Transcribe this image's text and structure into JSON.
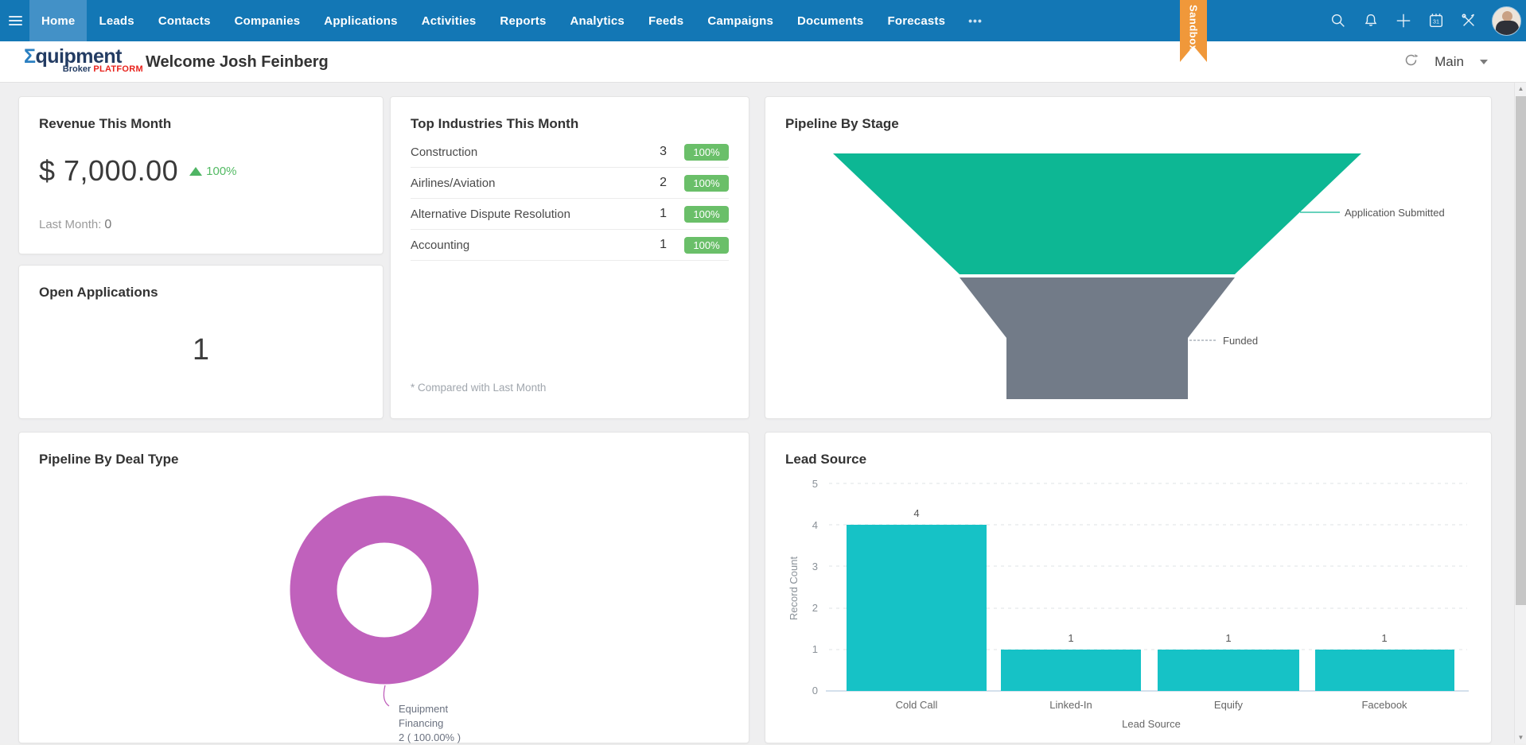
{
  "nav": {
    "items": [
      {
        "label": "Home",
        "active": true
      },
      {
        "label": "Leads"
      },
      {
        "label": "Contacts"
      },
      {
        "label": "Companies"
      },
      {
        "label": "Applications"
      },
      {
        "label": "Activities"
      },
      {
        "label": "Reports"
      },
      {
        "label": "Analytics"
      },
      {
        "label": "Feeds"
      },
      {
        "label": "Campaigns"
      },
      {
        "label": "Documents"
      },
      {
        "label": "Forecasts"
      }
    ],
    "more": "•••",
    "calendar_day": "31",
    "sandbox_label": "Sandbox"
  },
  "header": {
    "logo": {
      "sigma": "Σ",
      "name_rest": "quipment",
      "sub_left": "Broker",
      "sub_right": "PLATFORM"
    },
    "welcome": "Welcome Josh Feinberg",
    "view_selector": "Main"
  },
  "revenue_card": {
    "title": "Revenue This Month",
    "value": "$ 7,000.00",
    "change": "100%",
    "last_month_label": "Last Month:",
    "last_month_value": "0"
  },
  "industries_card": {
    "title": "Top Industries This Month",
    "rows": [
      {
        "name": "Construction",
        "count": "3",
        "change": "100%"
      },
      {
        "name": "Airlines/Aviation",
        "count": "2",
        "change": "100%"
      },
      {
        "name": "Alternative Dispute Resolution",
        "count": "1",
        "change": "100%"
      },
      {
        "name": "Accounting",
        "count": "1",
        "change": "100%"
      }
    ],
    "footnote": "* Compared with Last Month"
  },
  "open_apps_card": {
    "title": "Open Applications",
    "value": "1"
  },
  "funnel_card": {
    "title": "Pipeline By Stage",
    "stage1_label": "Application Submitted",
    "stage2_label": "Funded"
  },
  "dealtype_card": {
    "title": "Pipeline By Deal Type",
    "label_line1": "Equipment",
    "label_line2": "Financing",
    "label_line3": "2 ( 100.00% )"
  },
  "leadsource_card": {
    "title": "Lead Source",
    "xlabel": "Lead Source",
    "ylabel": "Record Count",
    "yticks": {
      "t5": "5",
      "t4": "4",
      "t3": "3",
      "t2": "2",
      "t1": "1",
      "t0": "0"
    },
    "bars": [
      {
        "label": "Cold Call",
        "value": "4"
      },
      {
        "label": "Linked-In",
        "value": "1"
      },
      {
        "label": "Equify",
        "value": "1"
      },
      {
        "label": "Facebook",
        "value": "1"
      }
    ]
  },
  "colors": {
    "nav_blue": "#1377b5",
    "nav_active_blue": "#4391c7",
    "sandbox_orange": "#f0983a",
    "badge_green": "#6abf69",
    "change_green": "#53ba63",
    "funnel_green": "#0db794",
    "funnel_gray": "#727b88",
    "donut_magenta": "#c061bc",
    "bar_cyan": "#16c2c6"
  },
  "chart_data": [
    {
      "type": "funnel",
      "title": "Pipeline By Stage",
      "stages": [
        {
          "label": "Application Submitted",
          "color": "#0db794"
        },
        {
          "label": "Funded",
          "color": "#727b88"
        }
      ]
    },
    {
      "type": "pie",
      "title": "Pipeline By Deal Type",
      "donut": true,
      "slices": [
        {
          "label": "Equipment Financing",
          "value": 2,
          "percent": "100.00%",
          "color": "#c061bc"
        }
      ]
    },
    {
      "type": "bar",
      "title": "Lead Source",
      "categories": [
        "Cold Call",
        "Linked-In",
        "Equify",
        "Facebook"
      ],
      "values": [
        4,
        1,
        1,
        1
      ],
      "xlabel": "Lead Source",
      "ylabel": "Record Count",
      "ylim": [
        0,
        5
      ],
      "grid": "dashed horizontal",
      "bar_color": "#16c2c6"
    }
  ]
}
